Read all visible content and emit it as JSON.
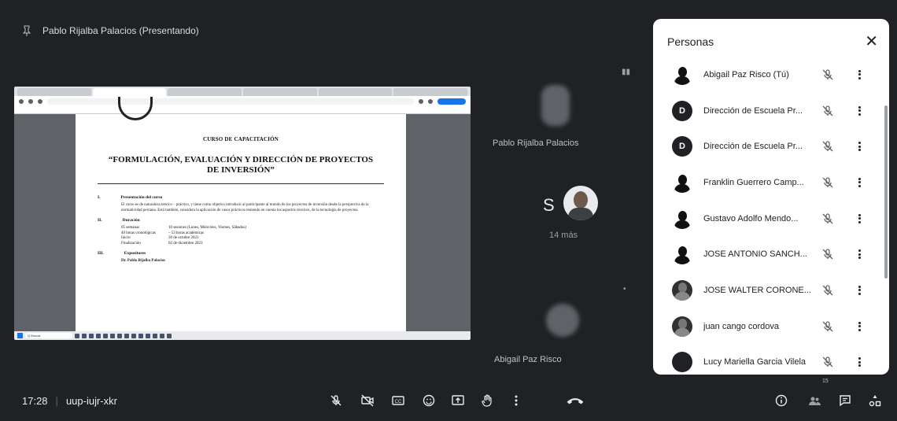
{
  "meeting": {
    "presenter_label": "Pablo Rijalba Palacios (Presentando)",
    "time": "17:28",
    "code": "uup-iujr-xkr"
  },
  "shared_document": {
    "course_label": "CURSO DE CAPACITACIÓN",
    "title_line1": "“FORMULACIÓN, EVALUACIÓN Y DIRECCIÓN DE PROYECTOS",
    "title_line2": "DE INVERSIÓN”",
    "sections": [
      {
        "num": "I.",
        "title": "Presentación del curso"
      },
      {
        "num": "II.",
        "title": "Duración"
      },
      {
        "num": "III.",
        "title": "Expositores"
      }
    ],
    "presentation_text": "El curso es de naturaleza teórico – práctico, y tiene como objetivo introducir al participante al mundo de los proyectos de inversión desde la perspectiva de la normatividad peruana. Está también, considera la aplicación de casos prácticos teniendo en cuenta los aspectos técnicos, de la tecnología de proyectos.",
    "duration_rows": [
      {
        "label": "05 semanas",
        "value": "10 sesiones (Lunes, Miércoles, Viernes, Sábados)"
      },
      {
        "label": "40 horas cronológicas",
        "value": "– 53 horas académicas"
      },
      {
        "label": "Inicio",
        "value": "30 de octubre 2023"
      },
      {
        "label": "Finalización",
        "value": "02 de diciembre 2023"
      }
    ],
    "expositor": "Dr. Pablo Rijalba Palacios",
    "taskbar_search": "Q Buscar"
  },
  "tiles": {
    "pablo_label": "Pablo Rijalba Palacios",
    "more_initial": "S",
    "more_count": "14 más",
    "abigail_label": "Abigail Paz Risco"
  },
  "people_panel": {
    "title": "Personas",
    "close_icon": "close-icon",
    "participants": [
      {
        "name": "Abigail Paz Risco (Tú)",
        "avatar": "photo",
        "initial": ""
      },
      {
        "name": "Dirección de Escuela Pr...",
        "avatar": "letter",
        "initial": "D"
      },
      {
        "name": "Dirección de Escuela Pr...",
        "avatar": "letter",
        "initial": "D"
      },
      {
        "name": "Franklin Guerrero Camp...",
        "avatar": "photo",
        "initial": ""
      },
      {
        "name": "Gustavo Adolfo Mendo...",
        "avatar": "photo",
        "initial": ""
      },
      {
        "name": "JOSE ANTONIO SANCH...",
        "avatar": "photo",
        "initial": ""
      },
      {
        "name": "JOSE WALTER CORONE...",
        "avatar": "photo-dark",
        "initial": ""
      },
      {
        "name": "juan cango cordova",
        "avatar": "photo-dark",
        "initial": ""
      },
      {
        "name": "Lucy Mariella Garcia Vilela",
        "avatar": "letter",
        "initial": ""
      }
    ]
  },
  "controls": {
    "left_icons": [
      "mic-off-icon",
      "camera-off-icon",
      "captions-icon",
      "emoji-icon",
      "present-icon",
      "raise-hand-icon",
      "more-options-icon",
      "end-call-icon"
    ],
    "right_icons": [
      "info-icon",
      "people-icon",
      "chat-icon",
      "activities-icon"
    ],
    "people_badge": "15"
  },
  "colors": {
    "background": "#202124",
    "panel": "#ffffff",
    "end_call": "#ea4335"
  }
}
